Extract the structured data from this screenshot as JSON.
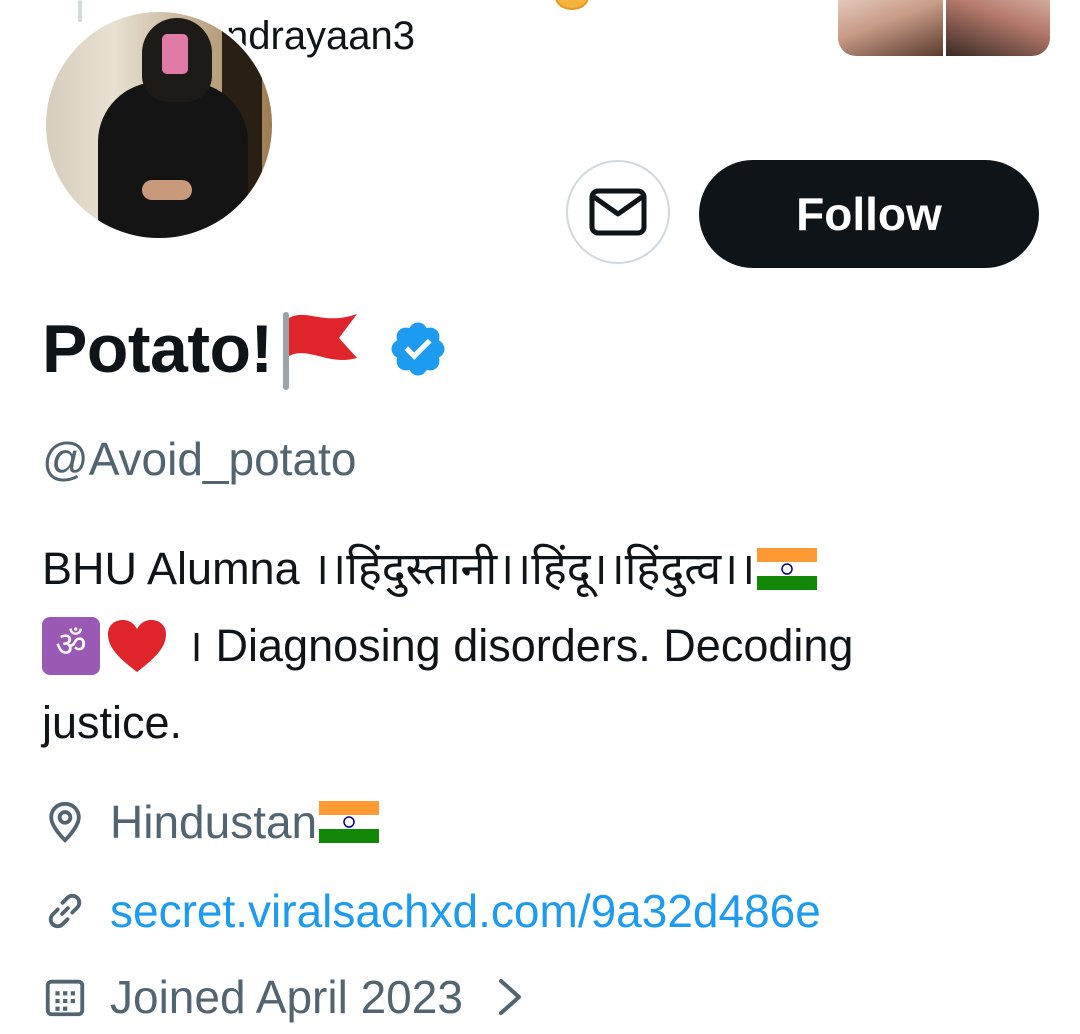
{
  "header": {
    "snippet_text": "ndrayaan3"
  },
  "actions": {
    "follow_label": "Follow"
  },
  "profile": {
    "display_name": "Potato!",
    "handle": "@Avoid_potato",
    "verified": true,
    "bio": {
      "line1": "BHU Alumna ।।हिंदुस्तानी।।हिंदू।।हिंदुत्व।।",
      "line2": "। Diagnosing disorders. Decoding",
      "line3": "justice."
    },
    "location": "Hindustan",
    "website": "secret.viralsachxd.com/9a32d486e",
    "joined": "Joined April 2023"
  },
  "icons": {
    "message": "mail-icon",
    "verified": "verified-badge-icon",
    "location": "location-pin-icon",
    "link": "link-icon",
    "calendar": "calendar-icon",
    "chevron": "chevron-right-icon"
  },
  "colors": {
    "text_primary": "#0f1419",
    "text_secondary": "#536471",
    "link": "#1d9bf0",
    "verified": "#1d9bf0",
    "follow_bg": "#0f1419"
  }
}
